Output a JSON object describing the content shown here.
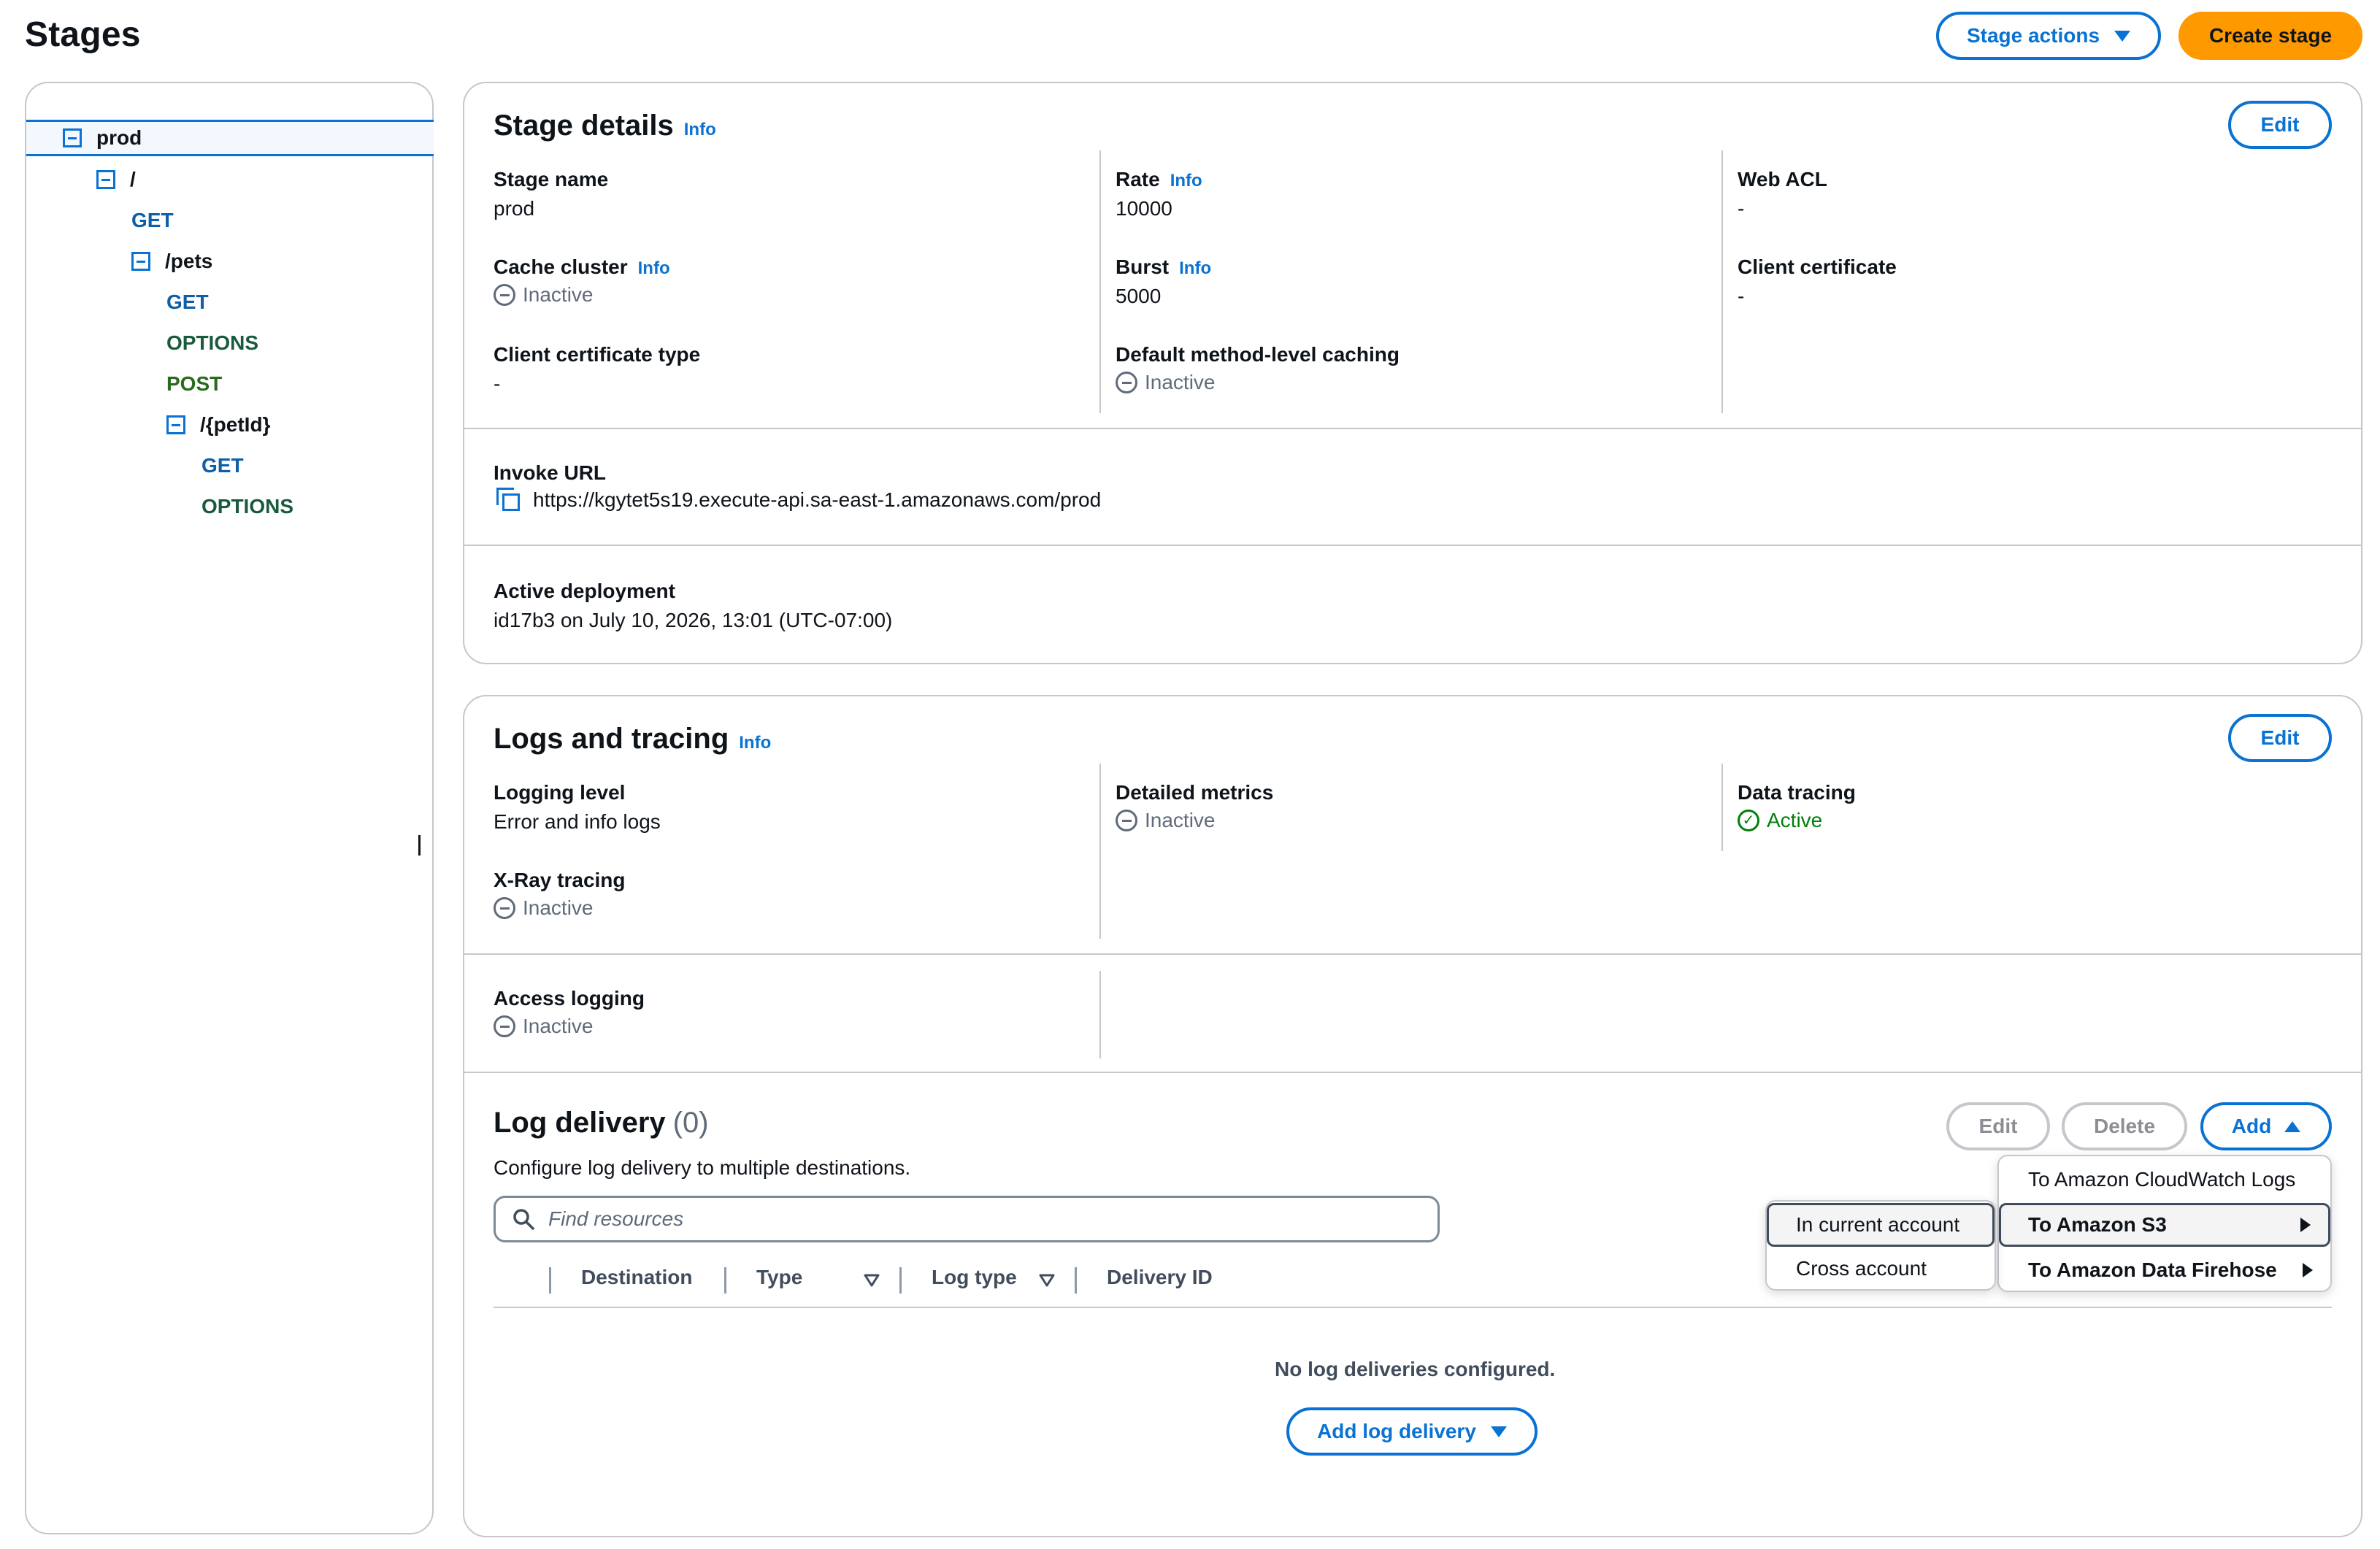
{
  "header": {
    "title": "Stages",
    "stage_actions_label": "Stage actions",
    "create_stage_label": "Create stage"
  },
  "tree": {
    "items": [
      {
        "label": "prod",
        "kind": "stage"
      },
      {
        "label": "/",
        "kind": "resource"
      },
      {
        "label": "GET",
        "kind": "method"
      },
      {
        "label": "/pets",
        "kind": "resource"
      },
      {
        "label": "GET",
        "kind": "method"
      },
      {
        "label": "OPTIONS",
        "kind": "method"
      },
      {
        "label": "POST",
        "kind": "method"
      },
      {
        "label": "/{petId}",
        "kind": "resource"
      },
      {
        "label": "GET",
        "kind": "method"
      },
      {
        "label": "OPTIONS",
        "kind": "method"
      }
    ]
  },
  "stage_details": {
    "title": "Stage details",
    "info": "Info",
    "edit_label": "Edit",
    "stage_name_label": "Stage name",
    "stage_name": "prod",
    "cache_cluster_label": "Cache cluster",
    "cache_cluster": "Inactive",
    "client_cert_type_label": "Client certificate type",
    "client_cert_type": "-",
    "rate_label": "Rate",
    "rate": "10000",
    "burst_label": "Burst",
    "burst": "5000",
    "default_caching_label": "Default method-level caching",
    "default_caching": "Inactive",
    "web_acl_label": "Web ACL",
    "web_acl": "-",
    "client_cert_label": "Client certificate",
    "client_cert": "-",
    "invoke_url_label": "Invoke URL",
    "invoke_url": "https://kgytet5s19.execute-api.sa-east-1.amazonaws.com/prod",
    "active_deployment_label": "Active deployment",
    "active_deployment": "id17b3 on July 10, 2026, 13:01 (UTC-07:00)"
  },
  "logs": {
    "title": "Logs and tracing",
    "info": "Info",
    "edit_label": "Edit",
    "logging_level_label": "Logging level",
    "logging_level": "Error and info logs",
    "xray_label": "X-Ray tracing",
    "xray": "Inactive",
    "detailed_metrics_label": "Detailed metrics",
    "detailed_metrics": "Inactive",
    "data_tracing_label": "Data tracing",
    "data_tracing": "Active",
    "access_logging_label": "Access logging",
    "access_logging": "Inactive"
  },
  "log_delivery": {
    "title": "Log delivery",
    "count": "(0)",
    "description": "Configure log delivery to multiple destinations.",
    "edit_label": "Edit",
    "delete_label": "Delete",
    "add_label": "Add",
    "search_placeholder": "Find resources",
    "columns": [
      "Destination",
      "Type",
      "Log type",
      "Delivery ID"
    ],
    "empty_text": "No log deliveries configured.",
    "add_log_delivery_label": "Add log delivery"
  },
  "add_menu": {
    "items": [
      "To Amazon CloudWatch Logs",
      "To Amazon S3",
      "To Amazon Data Firehose"
    ]
  },
  "s3_submenu": {
    "items": [
      "In current account",
      "Cross account"
    ]
  },
  "colors": {
    "link_blue": "#0972d3",
    "primary_orange": "#ff9900",
    "active_green": "#037f0c",
    "border_gray": "#c6c6cd"
  }
}
